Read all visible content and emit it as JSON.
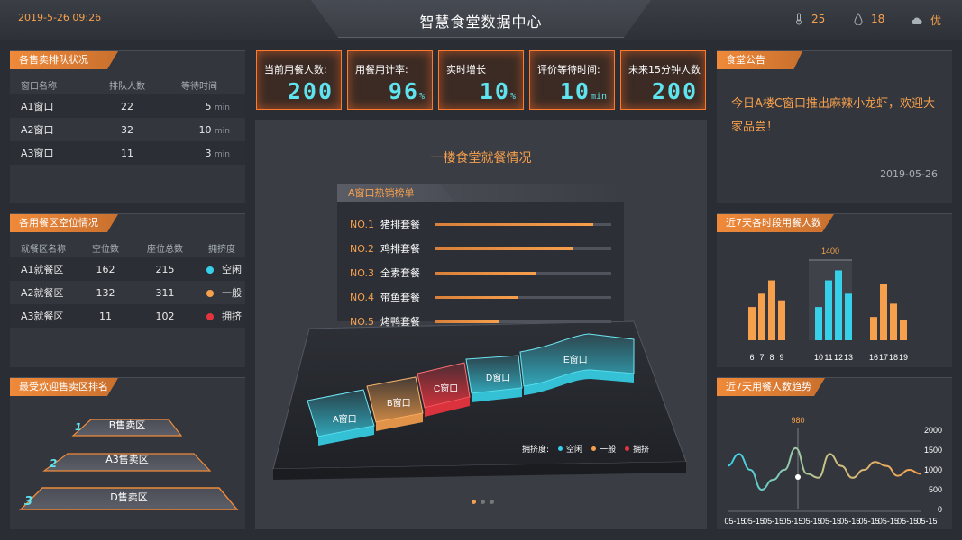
{
  "header": {
    "datetime": "2019-5-26  09:26",
    "title": "智慧食堂数据中心",
    "weather": {
      "temperature": "25",
      "humidity": "18",
      "air_quality": "优"
    }
  },
  "queue_panel": {
    "title": "各售卖排队状况",
    "columns": [
      "窗口名称",
      "排队人数",
      "等待时间"
    ],
    "unit": "min",
    "rows": [
      {
        "name": "A1窗口",
        "count": "22",
        "wait": "5"
      },
      {
        "name": "A2窗口",
        "count": "32",
        "wait": "10"
      },
      {
        "name": "A3窗口",
        "count": "11",
        "wait": "3"
      }
    ]
  },
  "seat_panel": {
    "title": "各用餐区空位情况",
    "columns": [
      "就餐区名称",
      "空位数",
      "座位总数",
      "拥挤度"
    ],
    "rows": [
      {
        "name": "A1就餐区",
        "empty": "162",
        "total": "215",
        "status": "空闲",
        "color": "#36d1e8"
      },
      {
        "name": "A2就餐区",
        "empty": "132",
        "total": "311",
        "status": "一般",
        "color": "#f6a04d"
      },
      {
        "name": "A3就餐区",
        "empty": "11",
        "total": "102",
        "status": "拥挤",
        "color": "#e5343e"
      }
    ]
  },
  "rank_panel": {
    "title": "最受欢迎售卖区排名",
    "items": [
      {
        "rank": "1",
        "label": "B售卖区"
      },
      {
        "rank": "2",
        "label": "A3售卖区"
      },
      {
        "rank": "3",
        "label": "D售卖区"
      }
    ]
  },
  "kpis": [
    {
      "label": "当前用餐人数:",
      "value": "200",
      "unit": ""
    },
    {
      "label": "用餐用计率:",
      "value": "96",
      "unit": "%"
    },
    {
      "label": "实时增长",
      "value": "10",
      "unit": "%"
    },
    {
      "label": "评价等待时间:",
      "value": "10",
      "unit": "min"
    },
    {
      "label": "未来15分钟人数",
      "value": "200",
      "unit": ""
    }
  ],
  "center": {
    "title": "一楼食堂就餐情况",
    "hot_title": "A窗口热销榜单",
    "hot_list": [
      {
        "no": "NO.1",
        "name": "猪排套餐",
        "level": 0.9
      },
      {
        "no": "NO.2",
        "name": "鸡排套餐",
        "level": 0.78
      },
      {
        "no": "NO.3",
        "name": "全素套餐",
        "level": 0.57
      },
      {
        "no": "NO.4",
        "name": "带鱼套餐",
        "level": 0.47
      },
      {
        "no": "NO.5",
        "name": "烤鸭套餐",
        "level": 0.36
      }
    ],
    "windows": [
      {
        "label": "A窗口",
        "status_color": "#36d1e8"
      },
      {
        "label": "B窗口",
        "status_color": "#f6a04d"
      },
      {
        "label": "C窗口",
        "status_color": "#e5343e"
      },
      {
        "label": "D窗口",
        "status_color": "#36d1e8"
      },
      {
        "label": "E窗口",
        "status_color": "#36d1e8"
      }
    ],
    "legend": {
      "title": "拥挤度:",
      "items": [
        {
          "label": "空闲",
          "color": "#36d1e8"
        },
        {
          "label": "一般",
          "color": "#f6a04d"
        },
        {
          "label": "拥挤",
          "color": "#e5343e"
        }
      ]
    }
  },
  "notice_panel": {
    "title": "食堂公告",
    "text": "今日A楼C窗口推出麻辣小龙虾，欢迎大家品尝！",
    "date": "2019-05-26"
  },
  "chart_data": [
    {
      "type": "bar",
      "title": "近7天各时段用餐人数",
      "categories": [
        "6",
        "7",
        "8",
        "9",
        "10",
        "11",
        "12",
        "13",
        "16",
        "17",
        "18",
        "19"
      ],
      "highlight_label": "1400",
      "series": [
        {
          "values": [
            500,
            700,
            900,
            600,
            500,
            900,
            1050,
            700,
            350,
            850,
            550,
            300
          ]
        }
      ],
      "group_colors": [
        "#f6a04d",
        "#f6a04d",
        "#f6a04d",
        "#f6a04d",
        "#36d1e8",
        "#36d1e8",
        "#36d1e8",
        "#36d1e8",
        "#f6a04d",
        "#f6a04d",
        "#f6a04d",
        "#f6a04d"
      ],
      "ylim": [
        0,
        1300
      ]
    },
    {
      "type": "line",
      "title": "近7天用餐人数趋势",
      "x": [
        "05-15",
        "05-15",
        "05-15",
        "05-15",
        "05-15",
        "05-15",
        "05-15",
        "05-15",
        "05-15",
        "05-15",
        "05-15"
      ],
      "yticks": [
        "2000",
        "1500",
        "1000",
        "500",
        "0"
      ],
      "ylim": [
        0,
        2000
      ],
      "highlight_label": "980",
      "series": [
        {
          "values": [
            1100,
            1400,
            1000,
            500,
            750,
            1000,
            1550,
            900,
            800,
            1400,
            1100,
            800,
            1000,
            1200,
            1100,
            850,
            1000,
            900
          ]
        }
      ]
    }
  ]
}
